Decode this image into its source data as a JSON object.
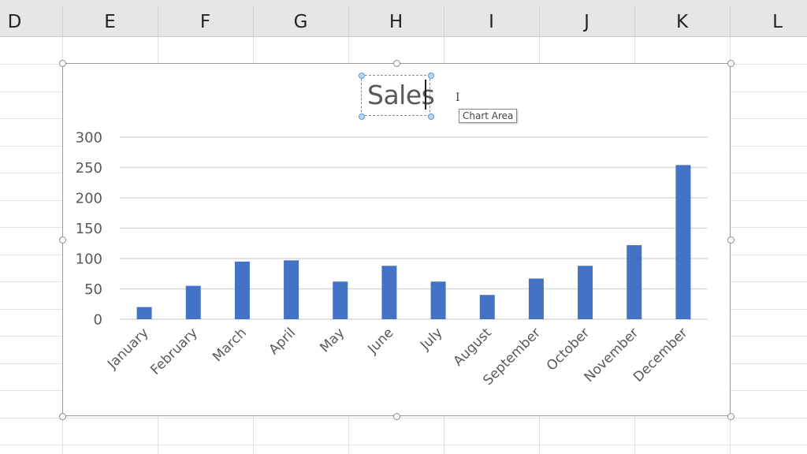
{
  "spreadsheet": {
    "columns": [
      "D",
      "E",
      "F",
      "G",
      "H",
      "I",
      "J",
      "K",
      "L"
    ]
  },
  "chart": {
    "title": "Sales",
    "tooltip": "Chart Area",
    "bar_color": "#4472c4",
    "gridline_color": "#d9d9d9",
    "text_color": "#595959",
    "selection_handle_color": "#5b9bd5"
  },
  "chart_data": {
    "type": "bar",
    "title": "Sales",
    "xlabel": "",
    "ylabel": "",
    "categories": [
      "January",
      "February",
      "March",
      "April",
      "May",
      "June",
      "July",
      "August",
      "September",
      "October",
      "November",
      "December"
    ],
    "values": [
      20,
      55,
      95,
      97,
      62,
      88,
      62,
      40,
      67,
      88,
      122,
      254
    ],
    "ylim": [
      0,
      300
    ],
    "yticks": [
      0,
      50,
      100,
      150,
      200,
      250,
      300
    ],
    "ytick_labels": [
      "0",
      "50",
      "100",
      "150",
      "200",
      "250",
      "300"
    ],
    "grid": true,
    "legend": "none",
    "xtick_rotation_deg": -45
  }
}
